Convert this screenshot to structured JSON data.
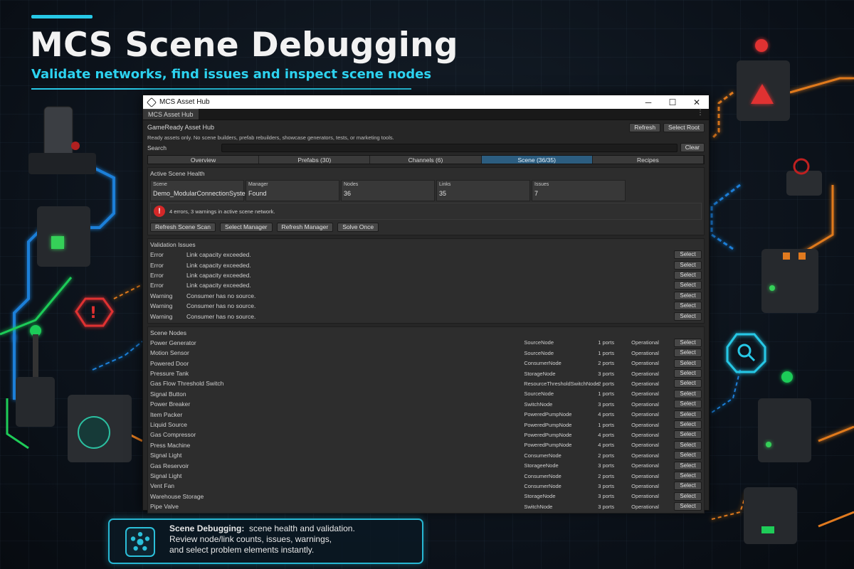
{
  "hero": {
    "title": "MCS Scene Debugging",
    "subtitle": "Validate networks, find issues and inspect scene nodes"
  },
  "window": {
    "title": "MCS Asset Hub",
    "tab_label": "MCS Asset Hub",
    "controls": {
      "minimize": "─",
      "maximize": "☐",
      "close": "✕"
    },
    "menu_glyph": "⋮"
  },
  "hub": {
    "title": "GameReady Asset Hub",
    "refresh_label": "Refresh",
    "select_root_label": "Select Root",
    "description": "Ready assets only. No scene builders, prefab rebuilders, showcase generators, tests, or marketing tools.",
    "search_label": "Search",
    "search_value": "",
    "clear_label": "Clear"
  },
  "tabs": [
    {
      "label": "Overview",
      "active": false
    },
    {
      "label": "Prefabs (30)",
      "active": false
    },
    {
      "label": "Channels (6)",
      "active": false
    },
    {
      "label": "Scene (36/35)",
      "active": true
    },
    {
      "label": "Recipes",
      "active": false
    }
  ],
  "health": {
    "title": "Active Scene Health",
    "stats": [
      {
        "label": "Scene",
        "value": "Demo_ModularConnectionSystems"
      },
      {
        "label": "Manager",
        "value": "Found"
      },
      {
        "label": "Nodes",
        "value": "36"
      },
      {
        "label": "Links",
        "value": "35"
      },
      {
        "label": "Issues",
        "value": "7"
      }
    ],
    "alert_glyph": "!",
    "alert": "4 errors, 3 warnings in active scene network.",
    "actions": [
      "Refresh Scene Scan",
      "Select Manager",
      "Refresh Manager",
      "Solve Once"
    ]
  },
  "validation": {
    "title": "Validation Issues",
    "select_label": "Select",
    "issues": [
      {
        "severity": "Error",
        "message": "Link capacity exceeded."
      },
      {
        "severity": "Error",
        "message": "Link capacity exceeded."
      },
      {
        "severity": "Error",
        "message": "Link capacity exceeded."
      },
      {
        "severity": "Error",
        "message": "Link capacity exceeded."
      },
      {
        "severity": "Warning",
        "message": "Consumer has no source."
      },
      {
        "severity": "Warning",
        "message": "Consumer has no source."
      },
      {
        "severity": "Warning",
        "message": "Consumer has no source."
      }
    ]
  },
  "scene_nodes": {
    "title": "Scene Nodes",
    "select_label": "Select",
    "nodes": [
      {
        "name": "Power Generator",
        "type": "SourceNode",
        "ports": "1 ports",
        "status": "Operational"
      },
      {
        "name": "Motion Sensor",
        "type": "SourceNode",
        "ports": "1 ports",
        "status": "Operational"
      },
      {
        "name": "Powered Door",
        "type": "ConsumerNode",
        "ports": "2 ports",
        "status": "Operational"
      },
      {
        "name": "Pressure Tank",
        "type": "StorageNode",
        "ports": "3 ports",
        "status": "Operational"
      },
      {
        "name": "Gas Flow Threshold Switch",
        "type": "ResourceThresholdSwitchNode",
        "ports": "2 ports",
        "status": "Operational"
      },
      {
        "name": "Signal Button",
        "type": "SourceNode",
        "ports": "1 ports",
        "status": "Operational"
      },
      {
        "name": "Power Breaker",
        "type": "SwitchNode",
        "ports": "3 ports",
        "status": "Operational"
      },
      {
        "name": "Item Packer",
        "type": "PoweredPumpNode",
        "ports": "4 ports",
        "status": "Operational"
      },
      {
        "name": "Liquid Source",
        "type": "PoweredPumpNode",
        "ports": "1 ports",
        "status": "Operational"
      },
      {
        "name": "Gas Compressor",
        "type": "PoweredPumpNode",
        "ports": "4 ports",
        "status": "Operational"
      },
      {
        "name": "Press Machine",
        "type": "PoweredPumpNode",
        "ports": "4 ports",
        "status": "Operational"
      },
      {
        "name": "Signal Light",
        "type": "ConsumerNode",
        "ports": "2 ports",
        "status": "Operational"
      },
      {
        "name": "Gas Reservoir",
        "type": "StorageeNode",
        "ports": "3 ports",
        "status": "Operational"
      },
      {
        "name": "Signal Light",
        "type": "ConsumerNode",
        "ports": "2 ports",
        "status": "Operational"
      },
      {
        "name": "Vent Fan",
        "type": "ConsumerNode",
        "ports": "3 ports",
        "status": "Operational"
      },
      {
        "name": "Warehouse Storage",
        "type": "StorageNode",
        "ports": "3 ports",
        "status": "Operational"
      },
      {
        "name": "Pipe Valve",
        "type": "SwitchNode",
        "ports": "3 ports",
        "status": "Operational"
      }
    ]
  },
  "caption": {
    "heading": "Scene Debugging:",
    "line1": "scene health and validation.",
    "line2": "Review node/link counts, issues, warnings,",
    "line3": "and select problem elements instantly."
  },
  "colors": {
    "accent": "#27c8e6",
    "active_tab": "#2c5d80",
    "error": "#d42828",
    "warning_orange": "#e07a1f",
    "green_glow": "#34d058",
    "blue_pipe": "#1e7fd8"
  }
}
